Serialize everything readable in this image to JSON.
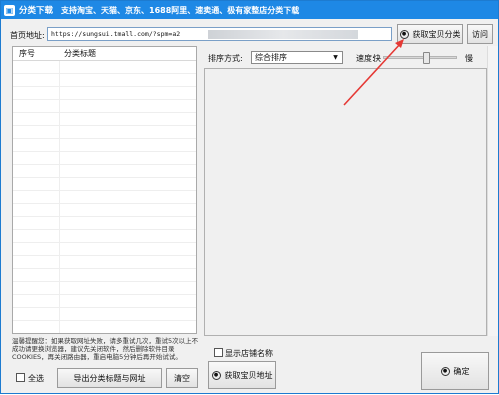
{
  "window": {
    "title": "分类下载",
    "subtitle": "支持淘宝、天猫、京东、1688阿里、速卖通、极有家整店分类下载"
  },
  "header": {
    "url_label": "首页地址:",
    "url_value": "https://sungsui.tmall.com/?spm=a2",
    "fetch_button": "获取宝贝分类",
    "visit_button": "访问"
  },
  "table": {
    "columns": [
      "序号",
      "分类标题"
    ]
  },
  "controls": {
    "sort_label": "排序方式:",
    "sort_value": "综合排序",
    "speed_label": "速度:",
    "speed_fast": "快",
    "speed_slow": "慢",
    "speed_level": 0.6
  },
  "notice": "温馨提醒您：如果获取网址失败，请多重试几次，重试5次以上不成功请更换浏览器，建议先关闭软件，然后删除软件目录COOKIES，再关闭路由器，重启电脑5分钟后再开始试试。",
  "footer": {
    "select_all": "全选",
    "export_button": "导出分类标题与网址",
    "clear_button": "清空",
    "show_shop_name": "显示店铺名称",
    "get_links_button": "获取宝贝地址",
    "confirm_button": "确定"
  },
  "colors": {
    "titlebar": "#1e88e5",
    "arrow": "#e53935"
  }
}
